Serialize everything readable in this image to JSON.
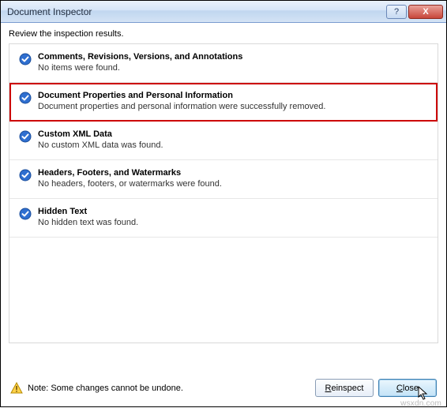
{
  "titlebar": {
    "title": "Document Inspector",
    "help_label": "?",
    "close_label": "X"
  },
  "instruction": "Review the inspection results.",
  "items": [
    {
      "title": "Comments, Revisions, Versions, and Annotations",
      "desc": "No items were found.",
      "highlight": false
    },
    {
      "title": "Document Properties and Personal Information",
      "desc": "Document properties and personal information were successfully removed.",
      "highlight": true
    },
    {
      "title": "Custom XML Data",
      "desc": "No custom XML data was found.",
      "highlight": false
    },
    {
      "title": "Headers, Footers, and Watermarks",
      "desc": "No headers, footers, or watermarks were found.",
      "highlight": false
    },
    {
      "title": "Hidden Text",
      "desc": "No hidden text was found.",
      "highlight": false
    }
  ],
  "footer": {
    "note": "Note: Some changes cannot be undone.",
    "reinspect_underline": "R",
    "reinspect_rest": "einspect",
    "close_underline": "C",
    "close_rest": "lose"
  },
  "watermark": "wsxdn.com"
}
